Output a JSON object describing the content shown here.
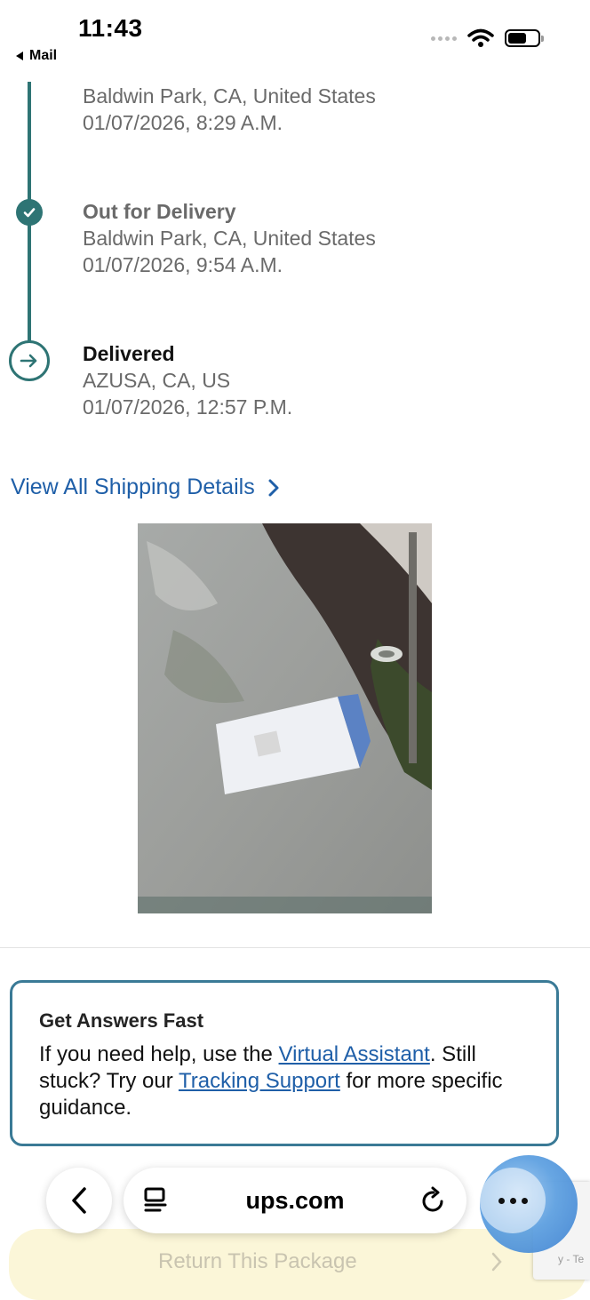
{
  "status_bar": {
    "time": "11:43",
    "back_app": "Mail"
  },
  "timeline": {
    "line_color": "#2e7474",
    "events": [
      {
        "status": "",
        "location": "Baldwin Park, CA, United States",
        "datetime": "01/07/2026, 8:29 A.M."
      },
      {
        "status": "Out for Delivery",
        "location": "Baldwin Park, CA, United States",
        "datetime": "01/07/2026, 9:54 A.M."
      },
      {
        "status": "Delivered",
        "location": "AZUSA, CA, US",
        "datetime": "01/07/2026, 12:57 P.M."
      }
    ]
  },
  "details_link": {
    "label": "View All Shipping Details",
    "color": "#1f5fa8"
  },
  "help_card": {
    "title": "Get Answers Fast",
    "text_1": "If you need help, use the ",
    "link_1": "Virtual Assistant",
    "text_2": ". Still stuck? Try our ",
    "link_2": "Tracking Support",
    "text_3": " for more specific guidance.",
    "border_color": "#3a7a96"
  },
  "bottom_bar": {
    "url": "ups.com",
    "return_button": "Return This Package",
    "recaptcha_fragment": "y - Te"
  }
}
